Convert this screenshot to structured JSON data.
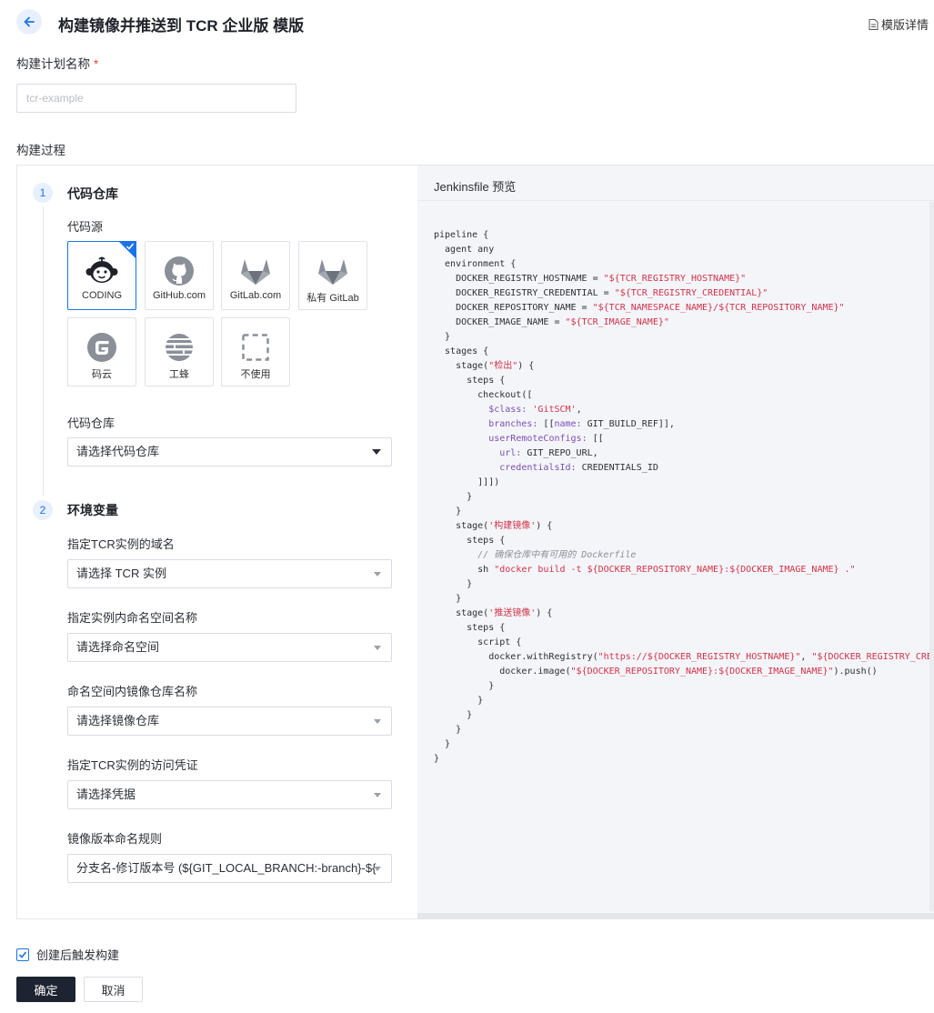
{
  "header": {
    "title": "构建镜像并推送到 TCR 企业版 模版",
    "detail_link": "模版详情"
  },
  "plan_name": {
    "label": "构建计划名称",
    "required_mark": "*",
    "value": "tcr-example"
  },
  "process": {
    "label": "构建过程",
    "steps": [
      {
        "number": "1",
        "title": "代码仓库"
      },
      {
        "number": "2",
        "title": "环境变量"
      }
    ],
    "code_source": {
      "label": "代码源",
      "tiles": [
        {
          "label": "CODING",
          "icon": "coding-monkey-icon",
          "selected": true
        },
        {
          "label": "GitHub.com",
          "icon": "github-icon"
        },
        {
          "label": "GitLab.com",
          "icon": "gitlab-icon"
        },
        {
          "label": "私有 GitLab",
          "icon": "gitlab-icon"
        },
        {
          "label": "码云",
          "icon": "gitee-icon"
        },
        {
          "label": "工蜂",
          "icon": "tgit-icon"
        },
        {
          "label": "不使用",
          "icon": "dashed-square-icon"
        }
      ]
    },
    "repo": {
      "label": "代码仓库",
      "placeholder": "请选择代码仓库"
    },
    "env": {
      "fields": [
        {
          "label": "指定TCR实例的域名",
          "placeholder": "请选择 TCR 实例"
        },
        {
          "label": "指定实例内命名空间名称",
          "placeholder": "请选择命名空间"
        },
        {
          "label": "命名空间内镜像仓库名称",
          "placeholder": "请选择镜像仓库"
        },
        {
          "label": "指定TCR实例的访问凭证",
          "placeholder": "请选择凭据"
        },
        {
          "label": "镜像版本命名规则",
          "value": "分支名-修订版本号 (${GIT_LOCAL_BRANCH:-branch}-${GIT_"
        }
      ]
    }
  },
  "preview": {
    "title": "Jenkinsfile 预览",
    "code": {
      "pipeline": "pipeline {",
      "agent": "  agent any",
      "environment": "  environment {",
      "env_hostname": [
        "    DOCKER_REGISTRY_HOSTNAME = ",
        "\"${TCR_REGISTRY_HOSTNAME}\""
      ],
      "env_credential": [
        "    DOCKER_REGISTRY_CREDENTIAL = ",
        "\"${TCR_REGISTRY_CREDENTIAL}\""
      ],
      "env_repo": [
        "    DOCKER_REPOSITORY_NAME = ",
        "\"${TCR_NAMESPACE_NAME}/${TCR_REPOSITORY_NAME}\""
      ],
      "env_image": [
        "    DOCKER_IMAGE_NAME = ",
        "\"${TCR_IMAGE_NAME}\""
      ],
      "close_env": "  }",
      "stages": "  stages {",
      "stage1": [
        "    stage(",
        "\"检出\"",
        ") {"
      ],
      "steps1": "      steps {",
      "checkout": "        checkout([",
      "class": [
        "          ",
        "$class:",
        " ",
        "'GitSCM'",
        ","
      ],
      "branches": [
        "          ",
        "branches:",
        " [[",
        "name:",
        " GIT_BUILD_REF]],"
      ],
      "remote": [
        "          ",
        "userRemoteConfigs:",
        " [["
      ],
      "url": [
        "            ",
        "url:",
        " GIT_REPO_URL,"
      ],
      "cred": [
        "            ",
        "credentialsId:",
        " CREDENTIALS_ID"
      ],
      "close_checkout": "        ]]])",
      "close_steps1": "      }",
      "close_stage1": "    }",
      "stage2": [
        "    stage(",
        "'构建镜像'",
        ") {"
      ],
      "steps2": "      steps {",
      "comment": "        // 确保仓库中有可用的 Dockerfile",
      "sh": [
        "        sh ",
        "\"docker build -t ${DOCKER_REPOSITORY_NAME}:${DOCKER_IMAGE_NAME} .\""
      ],
      "close_steps2": "      }",
      "close_stage2": "    }",
      "stage3": [
        "    stage(",
        "'推送镜像'",
        ") {"
      ],
      "steps3": "      steps {",
      "script": "        script {",
      "with_registry": [
        "          docker.withRegistry(",
        "\"https://${DOCKER_REGISTRY_HOSTNAME}\"",
        ", ",
        "\"${DOCKER_REGISTRY_CREDENTIAL}\""
      ],
      "push": [
        "            docker.image(",
        "\"${DOCKER_REPOSITORY_NAME}:${DOCKER_IMAGE_NAME}\"",
        ").push()"
      ],
      "close_wr": "          }",
      "close_script": "        }",
      "close_steps3": "      }",
      "close_stage3": "    }",
      "close_stages": "  }",
      "close_pipeline": "}"
    }
  },
  "footer": {
    "trigger_label": "创建后触发构建",
    "trigger_checked": true,
    "confirm": "确定",
    "cancel": "取消"
  },
  "colors": {
    "accent": "#1a73e8",
    "primary_button": "#1e2331",
    "string": "#d1324a",
    "key": "#7b4fb7"
  }
}
